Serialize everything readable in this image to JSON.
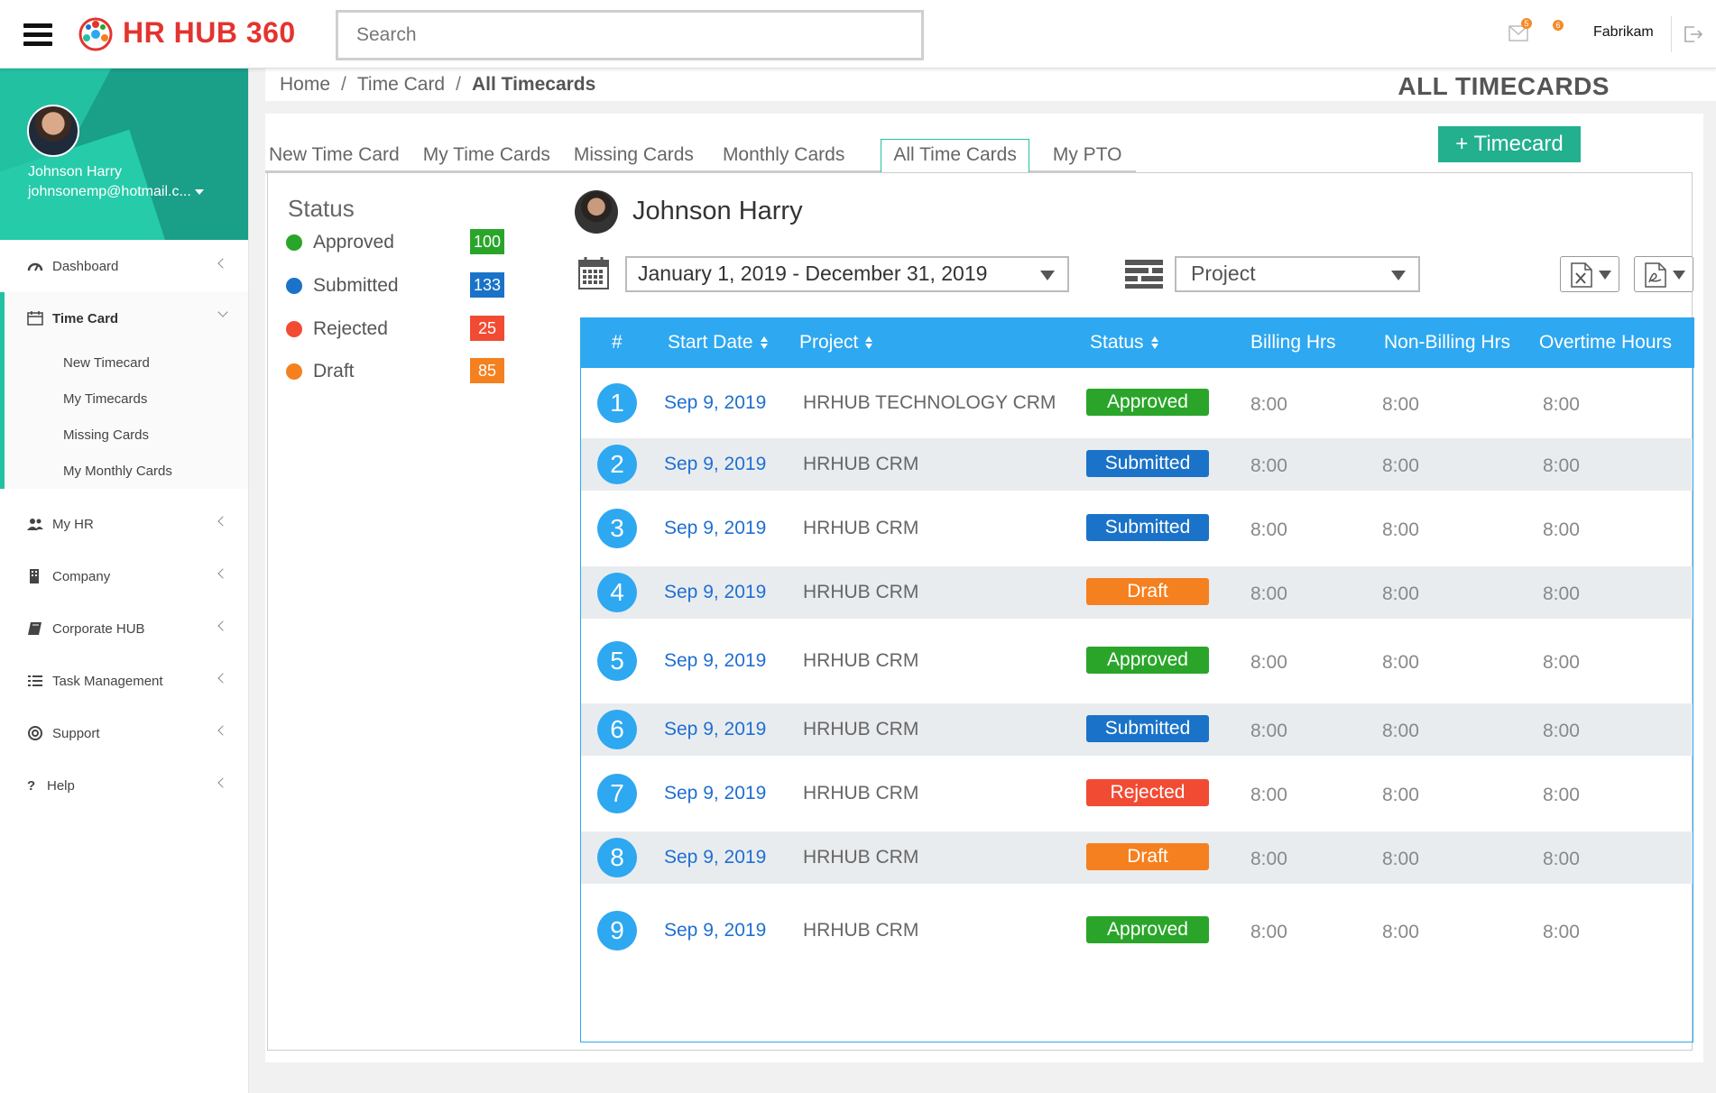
{
  "app": {
    "name": "HR HUB 360"
  },
  "header": {
    "search_placeholder": "Search",
    "mail_badge": "5",
    "notif_badge": "6",
    "company": "Fabrikam"
  },
  "profile": {
    "name": "Johnson Harry",
    "email": "johnsonemp@hotmail.c..."
  },
  "sidebar": {
    "items": [
      {
        "label": "Dashboard",
        "icon": "dashboard-icon"
      },
      {
        "label": "Time Card",
        "icon": "calendar-icon"
      },
      {
        "label": "My HR",
        "icon": "users-icon"
      },
      {
        "label": "Company",
        "icon": "building-icon"
      },
      {
        "label": "Corporate HUB",
        "icon": "book-icon"
      },
      {
        "label": "Task Management",
        "icon": "list-icon"
      },
      {
        "label": "Support",
        "icon": "lifebuoy-icon"
      },
      {
        "label": "Help",
        "icon": "question-icon"
      }
    ],
    "timecard_sub": [
      "New Timecard",
      "My Timecards",
      "Missing Cards",
      "My Monthly Cards"
    ]
  },
  "breadcrumb": [
    "Home",
    "Time Card",
    "All Timecards"
  ],
  "page_title": "ALL TIMECARDS",
  "tabs": [
    "New Time Card",
    "My Time Cards",
    "Missing Cards",
    "Monthly Cards",
    "All Time Cards",
    "My PTO"
  ],
  "add_button": "+ Timecard",
  "status": {
    "title": "Status",
    "items": [
      {
        "label": "Approved",
        "count": "100",
        "color": "#2aa52a"
      },
      {
        "label": "Submitted",
        "count": "133",
        "color": "#1a73c8"
      },
      {
        "label": "Rejected",
        "count": "25",
        "color": "#f24b33"
      },
      {
        "label": "Draft",
        "count": "85",
        "color": "#f5801f"
      }
    ]
  },
  "employee": {
    "name": "Johnson Harry"
  },
  "filters": {
    "date_range": "January 1, 2019 - December 31, 2019",
    "project": "Project"
  },
  "table": {
    "headers": [
      "#",
      "Start Date",
      "Project",
      "Status",
      "Billing Hrs",
      "Non-Billing Hrs",
      "Overtime Hours"
    ],
    "rows": [
      {
        "num": "1",
        "date": "Sep 9, 2019",
        "project": "HRHUB TECHNOLOGY CRM",
        "status": "Approved",
        "billing": "8:00",
        "nonbilling": "8:00",
        "overtime": "8:00"
      },
      {
        "num": "2",
        "date": "Sep 9, 2019",
        "project": "HRHUB CRM",
        "status": "Submitted",
        "billing": "8:00",
        "nonbilling": "8:00",
        "overtime": "8:00"
      },
      {
        "num": "3",
        "date": "Sep 9, 2019",
        "project": "HRHUB CRM",
        "status": "Submitted",
        "billing": "8:00",
        "nonbilling": "8:00",
        "overtime": "8:00"
      },
      {
        "num": "4",
        "date": "Sep 9, 2019",
        "project": "HRHUB CRM",
        "status": "Draft",
        "billing": "8:00",
        "nonbilling": "8:00",
        "overtime": "8:00"
      },
      {
        "num": "5",
        "date": "Sep 9, 2019",
        "project": "HRHUB CRM",
        "status": "Approved",
        "billing": "8:00",
        "nonbilling": "8:00",
        "overtime": "8:00"
      },
      {
        "num": "6",
        "date": "Sep 9, 2019",
        "project": "HRHUB CRM",
        "status": "Submitted",
        "billing": "8:00",
        "nonbilling": "8:00",
        "overtime": "8:00"
      },
      {
        "num": "7",
        "date": "Sep 9, 2019",
        "project": "HRHUB CRM",
        "status": "Rejected",
        "billing": "8:00",
        "nonbilling": "8:00",
        "overtime": "8:00"
      },
      {
        "num": "8",
        "date": "Sep 9, 2019",
        "project": "HRHUB CRM",
        "status": "Draft",
        "billing": "8:00",
        "nonbilling": "8:00",
        "overtime": "8:00"
      },
      {
        "num": "9",
        "date": "Sep 9, 2019",
        "project": "HRHUB CRM",
        "status": "Approved",
        "billing": "8:00",
        "nonbilling": "8:00",
        "overtime": "8:00"
      }
    ]
  },
  "colors": {
    "accent": "#22c1a1",
    "table_header": "#2ea8f0",
    "approved": "#2aa52a",
    "submitted": "#1a73c8",
    "rejected": "#f24b33",
    "draft": "#f5801f"
  }
}
